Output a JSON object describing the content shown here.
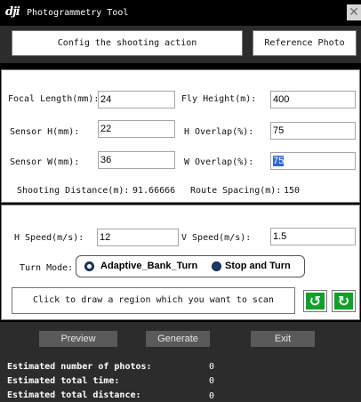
{
  "window": {
    "logo": "dji",
    "title": "Photogrammetry Tool",
    "close": "✕"
  },
  "header": {
    "config_button": "Config the shooting action",
    "reference_button": "Reference Photo"
  },
  "params": {
    "focal_length_label": "Focal Length(mm):",
    "focal_length_value": "24",
    "fly_height_label": "Fly Height(m):",
    "fly_height_value": "400",
    "sensor_h_label": "Sensor H(mm):",
    "sensor_h_value": "22",
    "h_overlap_label": "H Overlap(%):",
    "h_overlap_value": "75",
    "sensor_w_label": "Sensor W(mm):",
    "sensor_w_value": "36",
    "w_overlap_label": "W Overlap(%):",
    "w_overlap_value": "75",
    "shooting_distance_label": "Shooting Distance(m):",
    "shooting_distance_value": "91.66666",
    "route_spacing_label": "Route Spacing(m):",
    "route_spacing_value": "150"
  },
  "speed": {
    "h_speed_label": "H Speed(m/s):",
    "h_speed_value": "12",
    "v_speed_label": "V Speed(m/s):",
    "v_speed_value": "1.5",
    "turn_mode_label": "Turn Mode:",
    "turn_options": [
      "Adaptive_Bank_Turn",
      "Stop and Turn"
    ],
    "turn_selected": "Adaptive_Bank_Turn",
    "draw_region_button": "Click to draw a region which you want to scan",
    "rotate_ccw_icon": "↺",
    "rotate_cw_icon": "↻"
  },
  "actions": {
    "preview": "Preview",
    "generate": "Generate",
    "exit": "Exit"
  },
  "estimates": {
    "photos_label": "Estimated number of photos:",
    "photos_value": "0",
    "time_label": "Estimated total time:",
    "time_value": "0",
    "distance_label": "Estimated total distance:",
    "distance_value": "0"
  },
  "colors": {
    "accent_green": "#12a02a",
    "selection_blue": "#3367d6",
    "band_dark": "#2c2c2c"
  }
}
